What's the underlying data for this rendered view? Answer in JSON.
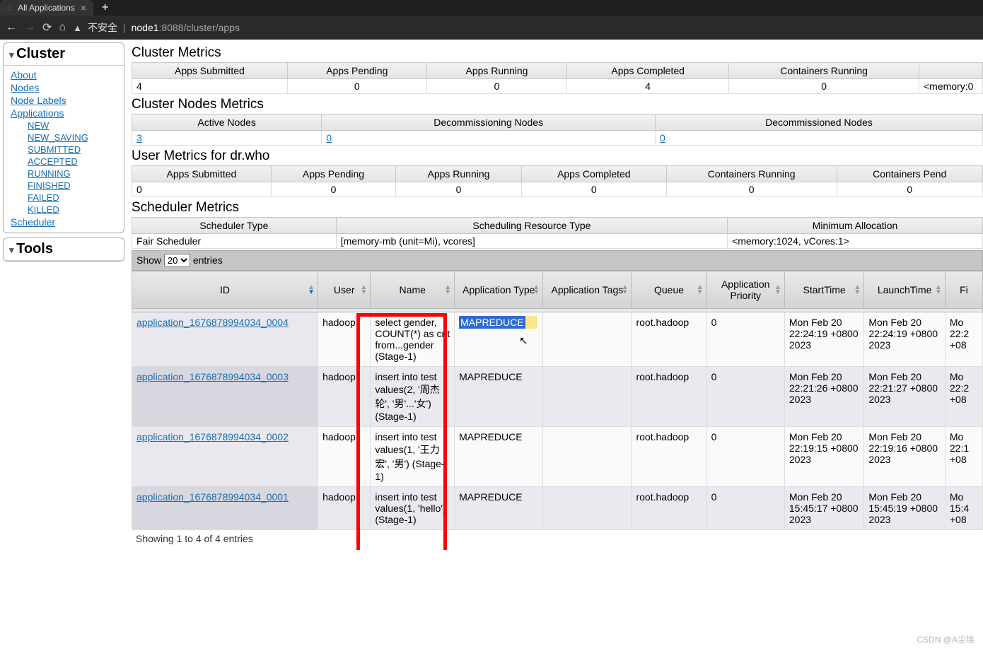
{
  "browser": {
    "tab_title": "All Applications",
    "security_label": "不安全",
    "url_host": "node1",
    "url_path": ":8088/cluster/apps"
  },
  "sidebar": {
    "cluster_title": "Cluster",
    "tools_title": "Tools",
    "links": {
      "about": "About",
      "nodes": "Nodes",
      "node_labels": "Node Labels",
      "applications": "Applications",
      "scheduler": "Scheduler"
    },
    "app_states": [
      "NEW",
      "NEW_SAVING",
      "SUBMITTED",
      "ACCEPTED",
      "RUNNING",
      "FINISHED",
      "FAILED",
      "KILLED"
    ]
  },
  "sections": {
    "cluster_metrics": "Cluster Metrics",
    "cluster_nodes_metrics": "Cluster Nodes Metrics",
    "user_metrics": "User Metrics for dr.who",
    "scheduler_metrics": "Scheduler Metrics"
  },
  "cluster_metrics": {
    "headers": [
      "Apps Submitted",
      "Apps Pending",
      "Apps Running",
      "Apps Completed",
      "Containers Running"
    ],
    "values": [
      "4",
      "0",
      "0",
      "4",
      "0"
    ],
    "extra_value": "<memory:0"
  },
  "cluster_nodes_metrics": {
    "headers": [
      "Active Nodes",
      "Decommissioning Nodes",
      "Decommissioned Nodes"
    ],
    "values": [
      "3",
      "0",
      "0"
    ]
  },
  "user_metrics": {
    "headers": [
      "Apps Submitted",
      "Apps Pending",
      "Apps Running",
      "Apps Completed",
      "Containers Running",
      "Containers Pend"
    ],
    "values": [
      "0",
      "0",
      "0",
      "0",
      "0",
      "0"
    ]
  },
  "scheduler_metrics": {
    "headers": [
      "Scheduler Type",
      "Scheduling Resource Type",
      "Minimum Allocation"
    ],
    "values": [
      "Fair Scheduler",
      "[memory-mb (unit=Mi), vcores]",
      "<memory:1024, vCores:1>"
    ]
  },
  "entries": {
    "show": "Show",
    "entries": "entries",
    "selected": "20"
  },
  "apps_table": {
    "headers": [
      "ID",
      "User",
      "Name",
      "Application Type",
      "Application Tags",
      "Queue",
      "Application Priority",
      "StartTime",
      "LaunchTime",
      "Fi"
    ],
    "rows": [
      {
        "id": "application_1676878994034_0004",
        "user": "hadoop",
        "name": "select gender, COUNT(*) as cnt from...gender (Stage-1)",
        "type": "MAPREDUCE",
        "type_selected": true,
        "tags": "",
        "queue": "root.hadoop",
        "priority": "0",
        "start": "Mon Feb 20 22:24:19 +0800 2023",
        "launch": "Mon Feb 20 22:24:19 +0800 2023",
        "fin": "Mo 22:2 +08"
      },
      {
        "id": "application_1676878994034_0003",
        "user": "hadoop",
        "name": "insert into test values(2, '周杰轮', '男'...'女') (Stage-1)",
        "type": "MAPREDUCE",
        "tags": "",
        "queue": "root.hadoop",
        "priority": "0",
        "start": "Mon Feb 20 22:21:26 +0800 2023",
        "launch": "Mon Feb 20 22:21:27 +0800 2023",
        "fin": "Mo 22:2 +08"
      },
      {
        "id": "application_1676878994034_0002",
        "user": "hadoop",
        "name": "insert into test values(1, '王力宏', '男') (Stage-1)",
        "type": "MAPREDUCE",
        "tags": "",
        "queue": "root.hadoop",
        "priority": "0",
        "start": "Mon Feb 20 22:19:15 +0800 2023",
        "launch": "Mon Feb 20 22:19:16 +0800 2023",
        "fin": "Mo 22:1 +08"
      },
      {
        "id": "application_1676878994034_0001",
        "user": "hadoop",
        "name": "insert into test values(1, 'hello') (Stage-1)",
        "type": "MAPREDUCE",
        "tags": "",
        "queue": "root.hadoop",
        "priority": "0",
        "start": "Mon Feb 20 15:45:17 +0800 2023",
        "launch": "Mon Feb 20 15:45:19 +0800 2023",
        "fin": "Mo 15:4 +08"
      }
    ]
  },
  "footer": "Showing 1 to 4 of 4 entries",
  "watermark": "CSDN @A尘埃"
}
